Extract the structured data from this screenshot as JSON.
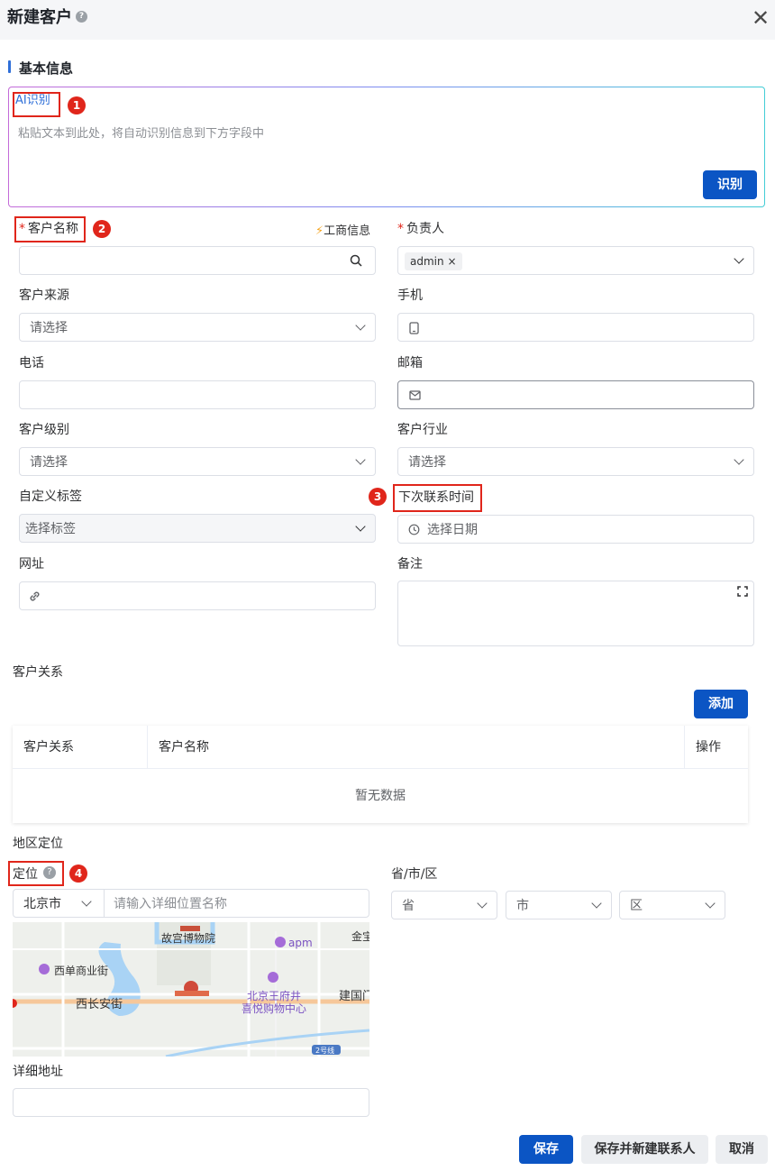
{
  "header": {
    "title": "新建客户",
    "help_icon": "?",
    "close_icon": "✕"
  },
  "section": {
    "basic_info": "基本信息"
  },
  "ai": {
    "label": "AI识别",
    "placeholder": "粘贴文本到此处，将自动识别信息到下方字段中",
    "button": "识别"
  },
  "annotations": {
    "n1": "1",
    "n2": "2",
    "n3": "3",
    "n4": "4"
  },
  "fields": {
    "customer_name": {
      "label": "客户名称",
      "required": "*",
      "business_link": "工商信息"
    },
    "owner": {
      "label": "负责人",
      "required": "*",
      "tag": "admin",
      "tag_remove": "×"
    },
    "source": {
      "label": "客户来源",
      "placeholder": "请选择"
    },
    "mobile": {
      "label": "手机"
    },
    "phone": {
      "label": "电话"
    },
    "email": {
      "label": "邮箱"
    },
    "level": {
      "label": "客户级别",
      "placeholder": "请选择"
    },
    "industry": {
      "label": "客户行业",
      "placeholder": "请选择"
    },
    "tags": {
      "label": "自定义标签",
      "placeholder": "选择标签"
    },
    "next_contact": {
      "label": "下次联系时间",
      "placeholder": "选择日期"
    },
    "website": {
      "label": "网址"
    },
    "remark": {
      "label": "备注"
    }
  },
  "relations": {
    "title": "客户关系",
    "add_button": "添加",
    "columns": [
      "客户关系",
      "客户名称",
      "操作"
    ],
    "empty": "暂无数据"
  },
  "region": {
    "title": "地区定位",
    "locate_label": "定位",
    "city": "北京市",
    "detail_placeholder": "请输入详细位置名称",
    "province_label": "省/市/区",
    "province": "省",
    "citysel": "市",
    "district": "区",
    "map_labels": {
      "palace": "故宫博物院",
      "xidan": "西单商业街",
      "xichangan": "西长安街",
      "wangfujing_1": "北京王府井",
      "wangfujing_2": "喜悦购物中心",
      "apm": "apm",
      "jianguomen": "建国门",
      "jinbao": "金宝",
      "line2": "2号线"
    },
    "detail_address_label": "详细地址"
  },
  "footer": {
    "save": "保存",
    "save_new_contact": "保存并新建联系人",
    "cancel": "取消"
  },
  "colors": {
    "primary": "#0b55c4",
    "required": "#e0261b",
    "annotation": "#e0261b",
    "accent_bar": "#2f6fd8"
  }
}
